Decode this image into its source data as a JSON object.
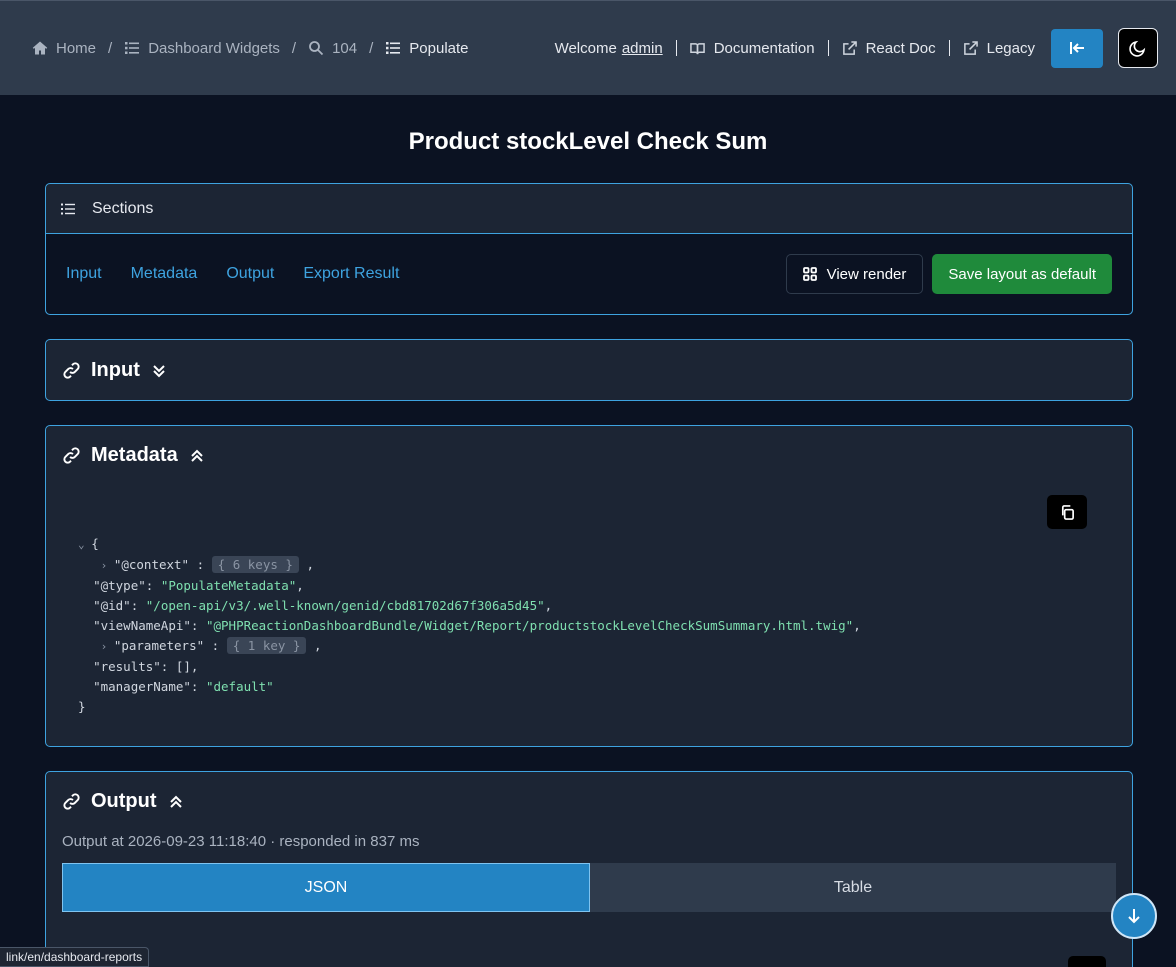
{
  "breadcrumb": {
    "home": "Home",
    "dashboard_widgets": "Dashboard Widgets",
    "id": "104",
    "current": "Populate",
    "separator": "/"
  },
  "nav": {
    "welcome": "Welcome",
    "user": "admin",
    "documentation": "Documentation",
    "react_doc": "React Doc",
    "legacy": "Legacy"
  },
  "page": {
    "title": "Product stockLevel Check Sum"
  },
  "sections": {
    "header": "Sections",
    "links": [
      "Input",
      "Metadata",
      "Output",
      "Export Result"
    ],
    "view_render": "View render",
    "save_layout": "Save layout as default"
  },
  "input_section": {
    "title": "Input"
  },
  "metadata_section": {
    "title": "Metadata",
    "json": {
      "open": "{",
      "close": "}",
      "context_key": "\"@context\"",
      "context_summary": "{ 6 keys }",
      "type_key": "\"@type\"",
      "type_val": "\"PopulateMetadata\"",
      "id_key": "\"@id\"",
      "id_val": "\"/open-api/v3/.well-known/genid/cbd81702d67f306a5d45\"",
      "viewname_key": "\"viewNameApi\"",
      "viewname_val": "\"@PHPReactionDashboardBundle/Widget/Report/productstockLevelCheckSumSummary.html.twig\"",
      "parameters_key": "\"parameters\"",
      "parameters_summary": "{ 1 key }",
      "results_key": "\"results\"",
      "results_val": "[]",
      "manager_key": "\"managerName\"",
      "manager_val": "\"default\""
    }
  },
  "output_section": {
    "title": "Output",
    "meta": "Output at 2026-09-23 11:18:40 · responded in 837 ms",
    "tabs": [
      "JSON",
      "Table"
    ]
  },
  "status_bar": {
    "url": "link/en/dashboard-reports"
  },
  "colors": {
    "accent": "#2384c3",
    "success": "#1f8a3b",
    "link": "#3ea3e0",
    "background": "#0b1222"
  }
}
